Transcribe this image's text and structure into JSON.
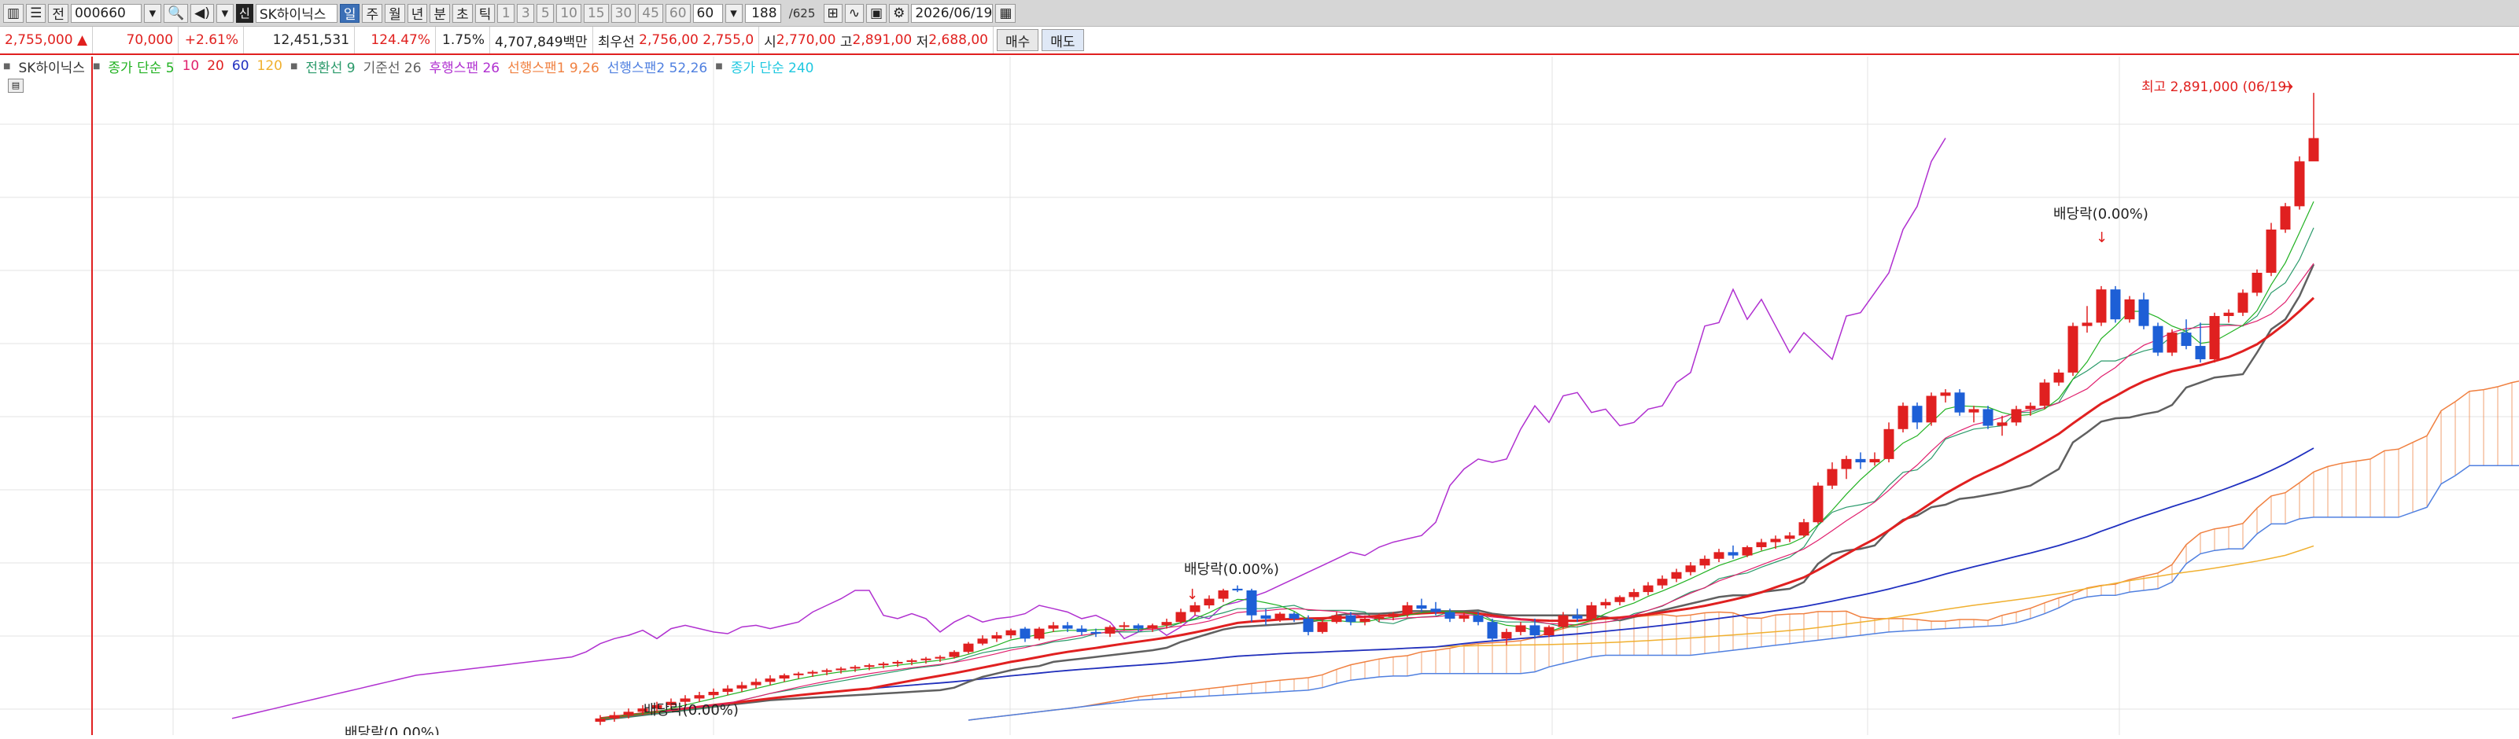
{
  "toolbar": {
    "mode_label": "전",
    "code": "000660",
    "name": "SK하이닉스",
    "stock_icon": "신",
    "periods": [
      "일",
      "주",
      "월",
      "년",
      "분",
      "초",
      "틱"
    ],
    "active_period": "일",
    "minutes": [
      "1",
      "3",
      "5",
      "10",
      "15",
      "30",
      "45",
      "60"
    ],
    "minute_value": "60",
    "count": "188",
    "total": "/625",
    "date": "2026/06/19",
    "icons": [
      "layout-icon",
      "menu-icon",
      "search-icon",
      "sound-icon",
      "chart-type-icon",
      "compare-icon",
      "save-icon",
      "settings-icon",
      "calendar-icon"
    ]
  },
  "info": {
    "price": "2,755,000",
    "arrow": "▲",
    "change": "70,000",
    "change_pct": "+2.61%",
    "volume": "12,451,531",
    "vol_ratio": "124.47%",
    "turnover": "1.75%",
    "amount": "4,707,849백만",
    "best_label": "최우선",
    "best_ask": "2,756,00",
    "best_bid": "2,755,0",
    "open_label": "시",
    "open": "2,770,00",
    "high_label": "고",
    "high": "2,891,00",
    "low_label": "저",
    "low": "2,688,00",
    "buy_label": "매수",
    "sell_label": "매도"
  },
  "legend": {
    "name": "SK하이닉스",
    "items": [
      {
        "text": "종가 단순 5",
        "color": "#22b222"
      },
      {
        "text": "10",
        "color": "#e0206e"
      },
      {
        "text": "20",
        "color": "#e02020"
      },
      {
        "text": "60",
        "color": "#2030c0"
      },
      {
        "text": "120",
        "color": "#f0b030"
      },
      {
        "text": "전환선 9",
        "color": "#2a9a6a"
      },
      {
        "text": "기준선 26",
        "color": "#606060"
      },
      {
        "text": "후행스팬 26",
        "color": "#b030d0"
      },
      {
        "text": "선행스팬1 9,26",
        "color": "#f08040"
      },
      {
        "text": "선행스팬2 52,26",
        "color": "#5080e0"
      },
      {
        "text": "종가 단순 240",
        "color": "#20c8e0"
      }
    ]
  },
  "chart_data": {
    "type": "candlestick",
    "title": "SK하이닉스",
    "ylim": [
      960000,
      3000000
    ],
    "annotations": [
      {
        "text": "최고 2,891,000 (06/19)",
        "color": "#e0201e"
      },
      {
        "text": "배당락(0.00%)"
      },
      {
        "text": "배당락(0.00%)"
      },
      {
        "text": "배당락(0.00%)"
      },
      {
        "text": "배당락(0.00%)"
      }
    ],
    "candles": [
      [
        1000000,
        1020000,
        990000,
        1010000
      ],
      [
        1010000,
        1030000,
        1000000,
        1020000
      ],
      [
        1020000,
        1040000,
        1010000,
        1030000
      ],
      [
        1030000,
        1050000,
        1020000,
        1040000
      ],
      [
        1040000,
        1060000,
        1030000,
        1050000
      ],
      [
        1050000,
        1070000,
        1040000,
        1060000
      ],
      [
        1060000,
        1080000,
        1050000,
        1070000
      ],
      [
        1070000,
        1090000,
        1060000,
        1080000
      ],
      [
        1080000,
        1100000,
        1070000,
        1090000
      ],
      [
        1090000,
        1110000,
        1080000,
        1100000
      ],
      [
        1100000,
        1120000,
        1090000,
        1110000
      ],
      [
        1110000,
        1130000,
        1100000,
        1120000
      ],
      [
        1120000,
        1140000,
        1110000,
        1130000
      ],
      [
        1130000,
        1145000,
        1120000,
        1140000
      ],
      [
        1140000,
        1150000,
        1130000,
        1145000
      ],
      [
        1145000,
        1155000,
        1135000,
        1150000
      ],
      [
        1150000,
        1160000,
        1140000,
        1155000
      ],
      [
        1155000,
        1165000,
        1145000,
        1160000
      ],
      [
        1160000,
        1170000,
        1150000,
        1165000
      ],
      [
        1165000,
        1175000,
        1155000,
        1170000
      ],
      [
        1170000,
        1180000,
        1160000,
        1175000
      ],
      [
        1175000,
        1185000,
        1165000,
        1180000
      ],
      [
        1180000,
        1190000,
        1170000,
        1185000
      ],
      [
        1185000,
        1195000,
        1175000,
        1190000
      ],
      [
        1190000,
        1200000,
        1180000,
        1195000
      ],
      [
        1195000,
        1215000,
        1190000,
        1210000
      ],
      [
        1210000,
        1240000,
        1205000,
        1235000
      ],
      [
        1235000,
        1260000,
        1230000,
        1250000
      ],
      [
        1250000,
        1270000,
        1240000,
        1260000
      ],
      [
        1260000,
        1280000,
        1250000,
        1275000
      ],
      [
        1280000,
        1285000,
        1240000,
        1250000
      ],
      [
        1250000,
        1285000,
        1245000,
        1280000
      ],
      [
        1280000,
        1300000,
        1270000,
        1290000
      ],
      [
        1290000,
        1300000,
        1270000,
        1280000
      ],
      [
        1280000,
        1290000,
        1260000,
        1270000
      ],
      [
        1270000,
        1280000,
        1255000,
        1265000
      ],
      [
        1265000,
        1290000,
        1255000,
        1285000
      ],
      [
        1285000,
        1300000,
        1275000,
        1290000
      ],
      [
        1290000,
        1295000,
        1270000,
        1280000
      ],
      [
        1280000,
        1295000,
        1270000,
        1290000
      ],
      [
        1290000,
        1310000,
        1280000,
        1300000
      ],
      [
        1300000,
        1340000,
        1295000,
        1330000
      ],
      [
        1330000,
        1360000,
        1320000,
        1350000
      ],
      [
        1350000,
        1380000,
        1340000,
        1370000
      ],
      [
        1370000,
        1400000,
        1360000,
        1395000
      ],
      [
        1400000,
        1410000,
        1390000,
        1395000
      ],
      [
        1395000,
        1400000,
        1300000,
        1320000
      ],
      [
        1320000,
        1340000,
        1290000,
        1310000
      ],
      [
        1310000,
        1330000,
        1300000,
        1325000
      ],
      [
        1325000,
        1330000,
        1300000,
        1310000
      ],
      [
        1310000,
        1320000,
        1260000,
        1270000
      ],
      [
        1270000,
        1310000,
        1265000,
        1300000
      ],
      [
        1300000,
        1330000,
        1295000,
        1320000
      ],
      [
        1320000,
        1330000,
        1290000,
        1300000
      ],
      [
        1300000,
        1320000,
        1290000,
        1310000
      ],
      [
        1310000,
        1325000,
        1300000,
        1315000
      ],
      [
        1315000,
        1330000,
        1305000,
        1325000
      ],
      [
        1325000,
        1360000,
        1315000,
        1350000
      ],
      [
        1350000,
        1370000,
        1330000,
        1340000
      ],
      [
        1340000,
        1360000,
        1320000,
        1330000
      ],
      [
        1330000,
        1340000,
        1300000,
        1310000
      ],
      [
        1310000,
        1330000,
        1300000,
        1320000
      ],
      [
        1320000,
        1330000,
        1290000,
        1300000
      ],
      [
        1300000,
        1310000,
        1240000,
        1250000
      ],
      [
        1250000,
        1280000,
        1230000,
        1270000
      ],
      [
        1270000,
        1300000,
        1260000,
        1290000
      ],
      [
        1290000,
        1310000,
        1250000,
        1260000
      ],
      [
        1260000,
        1290000,
        1255000,
        1285000
      ],
      [
        1285000,
        1330000,
        1280000,
        1320000
      ],
      [
        1320000,
        1340000,
        1300000,
        1310000
      ],
      [
        1310000,
        1360000,
        1305000,
        1350000
      ],
      [
        1350000,
        1370000,
        1340000,
        1360000
      ],
      [
        1360000,
        1380000,
        1350000,
        1375000
      ],
      [
        1375000,
        1400000,
        1365000,
        1390000
      ],
      [
        1390000,
        1420000,
        1380000,
        1410000
      ],
      [
        1410000,
        1440000,
        1400000,
        1430000
      ],
      [
        1430000,
        1460000,
        1420000,
        1450000
      ],
      [
        1450000,
        1480000,
        1440000,
        1470000
      ],
      [
        1470000,
        1500000,
        1460000,
        1490000
      ],
      [
        1490000,
        1520000,
        1480000,
        1510000
      ],
      [
        1510000,
        1530000,
        1490000,
        1500000
      ],
      [
        1500000,
        1530000,
        1495000,
        1525000
      ],
      [
        1525000,
        1550000,
        1515000,
        1540000
      ],
      [
        1540000,
        1560000,
        1520000,
        1550000
      ],
      [
        1550000,
        1570000,
        1540000,
        1560000
      ],
      [
        1560000,
        1610000,
        1555000,
        1600000
      ],
      [
        1600000,
        1720000,
        1595000,
        1710000
      ],
      [
        1710000,
        1780000,
        1700000,
        1760000
      ],
      [
        1760000,
        1800000,
        1730000,
        1790000
      ],
      [
        1790000,
        1810000,
        1760000,
        1780000
      ],
      [
        1780000,
        1810000,
        1770000,
        1790000
      ],
      [
        1790000,
        1900000,
        1780000,
        1880000
      ],
      [
        1880000,
        1960000,
        1870000,
        1950000
      ],
      [
        1950000,
        1960000,
        1880000,
        1900000
      ],
      [
        1900000,
        1990000,
        1890000,
        1980000
      ],
      [
        1980000,
        2000000,
        1960000,
        1990000
      ],
      [
        1990000,
        2000000,
        1920000,
        1930000
      ],
      [
        1930000,
        1950000,
        1900000,
        1940000
      ],
      [
        1940000,
        1950000,
        1880000,
        1890000
      ],
      [
        1890000,
        1920000,
        1860000,
        1900000
      ],
      [
        1900000,
        1950000,
        1890000,
        1940000
      ],
      [
        1940000,
        1960000,
        1920000,
        1950000
      ],
      [
        1950000,
        2030000,
        1940000,
        2020000
      ],
      [
        2020000,
        2060000,
        2010000,
        2050000
      ],
      [
        2050000,
        2200000,
        2040000,
        2190000
      ],
      [
        2190000,
        2250000,
        2170000,
        2200000
      ],
      [
        2200000,
        2310000,
        2190000,
        2300000
      ],
      [
        2300000,
        2310000,
        2200000,
        2210000
      ],
      [
        2210000,
        2280000,
        2200000,
        2270000
      ],
      [
        2270000,
        2290000,
        2180000,
        2190000
      ],
      [
        2190000,
        2200000,
        2100000,
        2110000
      ],
      [
        2110000,
        2180000,
        2100000,
        2170000
      ],
      [
        2170000,
        2210000,
        2120000,
        2130000
      ],
      [
        2130000,
        2200000,
        2080000,
        2090000
      ],
      [
        2090000,
        2230000,
        2080000,
        2220000
      ],
      [
        2220000,
        2240000,
        2200000,
        2230000
      ],
      [
        2230000,
        2300000,
        2220000,
        2290000
      ],
      [
        2290000,
        2360000,
        2280000,
        2350000
      ],
      [
        2350000,
        2500000,
        2340000,
        2480000
      ],
      [
        2480000,
        2560000,
        2470000,
        2550000
      ],
      [
        2550000,
        2700000,
        2540000,
        2685000
      ],
      [
        2685000,
        2891000,
        2688000,
        2755000
      ]
    ],
    "series": [
      {
        "name": "종가 단순 5"
      },
      {
        "name": "10"
      },
      {
        "name": "20"
      },
      {
        "name": "60"
      },
      {
        "name": "120"
      },
      {
        "name": "전환선 9"
      },
      {
        "name": "기준선 26"
      },
      {
        "name": "후행스팬 26"
      },
      {
        "name": "선행스팬1 9,26"
      },
      {
        "name": "선행스팬2 52,26"
      },
      {
        "name": "종가 단순 240"
      }
    ]
  }
}
